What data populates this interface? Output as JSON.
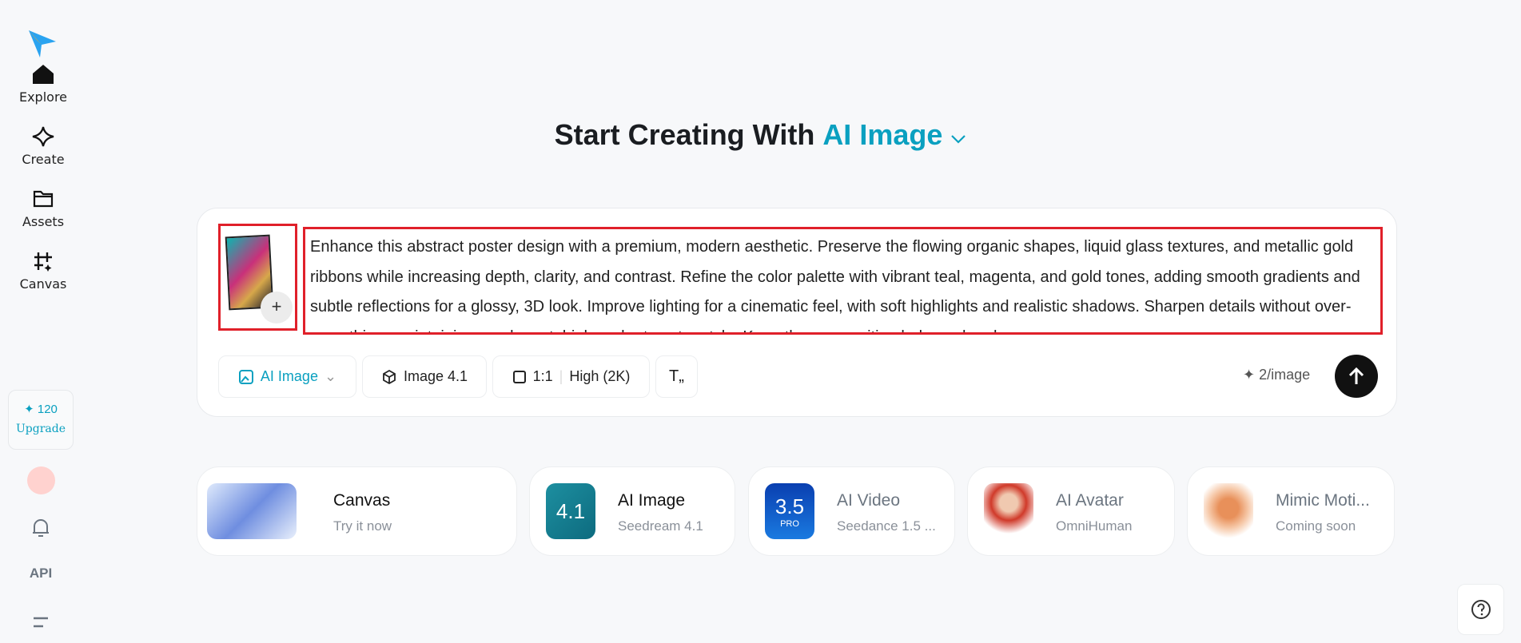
{
  "sidebar": {
    "items": [
      {
        "label": "Explore"
      },
      {
        "label": "Create"
      },
      {
        "label": "Assets"
      },
      {
        "label": "Canvas"
      }
    ],
    "credits": "120",
    "upgrade": "Upgrade",
    "api": "API"
  },
  "header": {
    "title": "Start Creating With",
    "mode": "AI Image"
  },
  "prompt": {
    "text": "Enhance this abstract poster design with a premium, modern aesthetic. Preserve the flowing organic shapes, liquid glass textures, and metallic gold ribbons while increasing depth, clarity, and contrast. Refine the color palette with vibrant teal, magenta, and gold tones, adding smooth gradients and subtle reflections for a glossy, 3D look. Improve lighting for a cinematic feel, with soft highlights and realistic shadows. Sharpen details without over-smoothing, maintaining an elegant, high-end art poster style. Keep the composition balanced and"
  },
  "toolbar": {
    "mode": "AI Image",
    "model": "Image 4.1",
    "ratio": "1:1",
    "quality": "High (2K)",
    "cost": "2/image"
  },
  "tiles": [
    {
      "title": "Canvas",
      "subtitle": "Try it now"
    },
    {
      "title": "AI Image",
      "subtitle": "Seedream 4.1",
      "badge": "4.1"
    },
    {
      "title": "AI Video",
      "subtitle": "Seedance 1.5 ...",
      "badge": "3.5",
      "badge2": "PRO"
    },
    {
      "title": "AI Avatar",
      "subtitle": "OmniHuman"
    },
    {
      "title": "Mimic Moti...",
      "subtitle": "Coming soon"
    }
  ],
  "colors": {
    "accent": "#0aa0c0",
    "highlight": "#e0202a"
  }
}
